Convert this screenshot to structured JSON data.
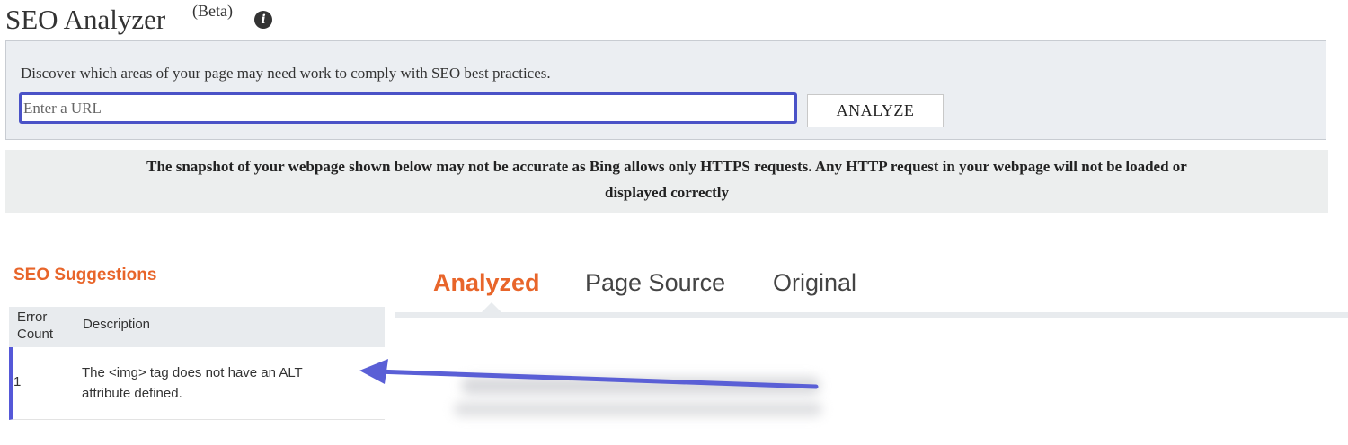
{
  "header": {
    "title": "SEO Analyzer",
    "beta": "(Beta)",
    "info_icon": "info-circle-icon",
    "info_glyph": "i"
  },
  "analyzer": {
    "description": "Discover which areas of your page may need work to comply with SEO best practices.",
    "url_value": "",
    "url_placeholder": "Enter a URL",
    "analyze_label": "ANALYZE"
  },
  "notice": {
    "line1": "The snapshot of your webpage shown below may not be accurate as Bing allows only HTTPS requests. Any HTTP request in your webpage will not be loaded or",
    "line2": "displayed correctly"
  },
  "suggestions": {
    "title": "SEO Suggestions",
    "columns": {
      "error_count_line1": "Error",
      "error_count_line2": "Count",
      "description": "Description"
    },
    "rows": [
      {
        "count": "1",
        "description": "The <img> tag does not have an ALT attribute defined."
      }
    ]
  },
  "tabs": [
    {
      "label": "Analyzed",
      "active": true
    },
    {
      "label": "Page Source",
      "active": false
    },
    {
      "label": "Original",
      "active": false
    }
  ],
  "colors": {
    "accent_orange": "#e8652a",
    "focus_blue": "#4a52c7",
    "row_marker": "#5558d8",
    "annotation_arrow": "#5a5fd6"
  }
}
